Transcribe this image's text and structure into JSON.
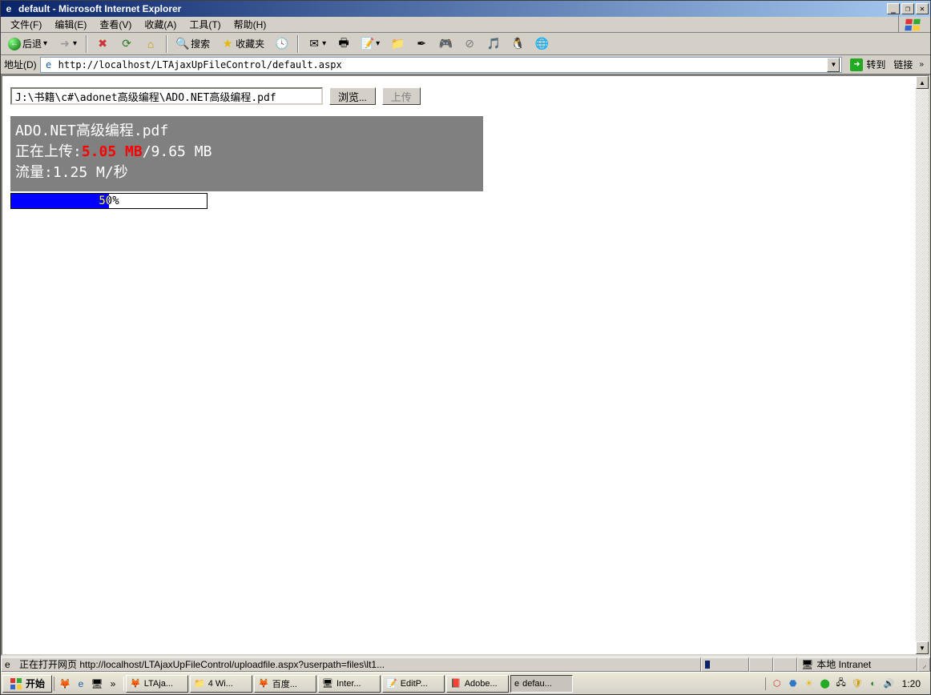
{
  "window": {
    "title": "default - Microsoft Internet Explorer"
  },
  "menu": {
    "file": "文件(F)",
    "edit": "编辑(E)",
    "view": "查看(V)",
    "favorites": "收藏(A)",
    "tools": "工具(T)",
    "help": "帮助(H)"
  },
  "toolbar": {
    "back": "后退",
    "search": "搜索",
    "favorites": "收藏夹"
  },
  "address": {
    "label": "地址(D)",
    "url": "http://localhost/LTAjaxUpFileControl/default.aspx",
    "go": "转到",
    "links": "链接"
  },
  "page": {
    "file_path": "J:\\书籍\\c#\\adonet高级编程\\ADO.NET高级编程.pdf",
    "browse": "浏览...",
    "upload": "上传",
    "upload_filename": "ADO.NET高级编程.pdf",
    "uploading_prefix": "正在上传:",
    "uploaded_size": "5.05 MB",
    "sep": "/",
    "total_size": "9.65 MB",
    "rate_prefix": "流量:",
    "rate_value": "1.25 M/秒",
    "progress_percent": 50,
    "progress_label": "50%"
  },
  "status": {
    "text": "正在打开网页 http://localhost/LTAjaxUpFileControl/uploadfile.aspx?userpath=files\\lt1...",
    "zone": "本地 Intranet"
  },
  "taskbar": {
    "start": "开始",
    "more": "»",
    "tasks": [
      "LTAja...",
      "4 Wi...",
      "百度...",
      "Inter...",
      "EditP...",
      "Adobe...",
      "defau..."
    ],
    "clock": "1:20"
  }
}
